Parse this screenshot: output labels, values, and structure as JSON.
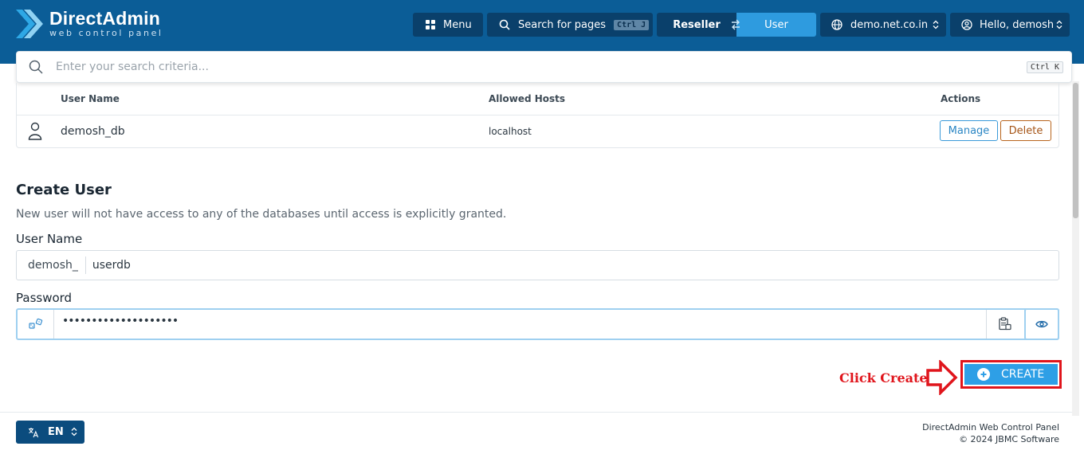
{
  "brand": {
    "title": "DirectAdmin",
    "subtitle": "web control panel"
  },
  "header": {
    "menu_label": "Menu",
    "search_label": "Search for pages",
    "search_shortcut": "Ctrl J",
    "mode_reseller": "Reseller",
    "mode_user": "User",
    "active_mode": "User",
    "domain": "demo.net.co.in",
    "greeting": "Hello, demosh"
  },
  "global_search": {
    "placeholder": "Enter your search criteria...",
    "shortcut": "Ctrl K"
  },
  "users_table": {
    "columns": [
      "User Name",
      "Allowed Hosts",
      "Actions"
    ],
    "rows": [
      {
        "user": "demosh_db",
        "host": "localhost",
        "manage": "Manage",
        "delete": "Delete"
      }
    ]
  },
  "create_user": {
    "title": "Create User",
    "description": "New user will not have access to any of the databases until access is explicitly granted.",
    "username_label": "User Name",
    "username_prefix": "demosh_",
    "username_value": "userdb",
    "password_label": "Password",
    "password_value": "••••••••••••••••••••",
    "create_label": "CREATE"
  },
  "annotation": {
    "text": "Click Create",
    "color": "#e0151c"
  },
  "footer": {
    "language": "EN",
    "line1": "DirectAdmin Web Control Panel",
    "line2": "© 2024 JBMC Software"
  },
  "colors": {
    "header": "#0b5d97",
    "accent": "#2e9fe6",
    "dark_button": "#0a406b"
  }
}
